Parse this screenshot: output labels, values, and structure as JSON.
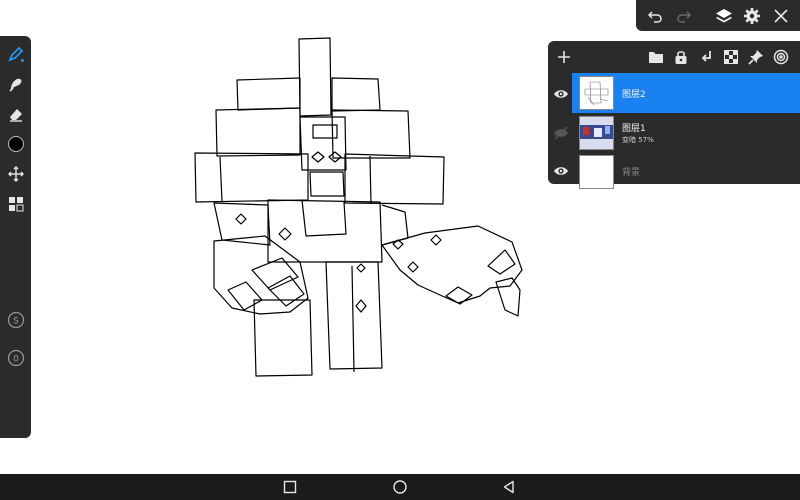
{
  "app": {
    "accent_color": "#1a82f0",
    "panel_color": "#2b2b2b"
  },
  "tools": [
    {
      "name": "brush-icon",
      "active": true
    },
    {
      "name": "smudge-icon"
    },
    {
      "name": "eraser-icon"
    },
    {
      "name": "color-swatch",
      "color": "#000000"
    },
    {
      "name": "move-icon"
    },
    {
      "name": "layers-grid-icon"
    }
  ],
  "side_controls": {
    "size_label": "S",
    "opacity_label": "0"
  },
  "topbar": {
    "icons": [
      "undo-icon",
      "redo-icon",
      "layers-icon",
      "gear-icon",
      "close-icon"
    ]
  },
  "layers_panel": {
    "toolbar_icons": [
      "add-icon",
      "folder-icon",
      "lock-icon",
      "merge-down-icon",
      "checker-icon",
      "pin-icon",
      "spiral-icon"
    ],
    "layers": [
      {
        "name": "图层2",
        "sub": "",
        "visible": true,
        "active": true
      },
      {
        "name": "图层1",
        "sub": "变暗  57%",
        "visible": false,
        "active": false
      },
      {
        "name": "背景",
        "sub": "",
        "visible": true,
        "active": false
      }
    ]
  },
  "navbar": {
    "icons": [
      "recent-apps-icon",
      "home-icon",
      "back-icon"
    ]
  }
}
